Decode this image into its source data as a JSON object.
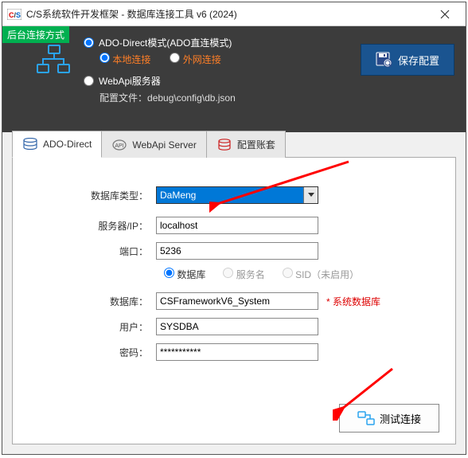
{
  "window": {
    "title": "C/S系统软件开发框架 - 数据库连接工具 v6 (2024)"
  },
  "header": {
    "tag": "后台连接方式",
    "mode1": "ADO-Direct模式(ADO直连模式)",
    "sub_local": "本地连接",
    "sub_remote": "外网连接",
    "mode2": "WebApi服务器",
    "config_label": "配置文件：",
    "config_path": "debug\\config\\db.json",
    "save_btn": "保存配置"
  },
  "tabs": {
    "t1": "ADO-Direct",
    "t2": "WebApi Server",
    "t3": "配置账套"
  },
  "form": {
    "db_type_label": "数据库类型：",
    "db_type_value": "DaMeng",
    "server_label": "服务器/IP：",
    "server_value": "localhost",
    "port_label": "端口：",
    "port_value": "5236",
    "opt_db": "数据库",
    "opt_svc": "服务名",
    "opt_sid": "SID（未启用）",
    "db_label": "数据库：",
    "db_value": "CSFrameworkV6_System",
    "db_hint": "* 系统数据库",
    "user_label": "用户：",
    "user_value": "SYSDBA",
    "pwd_label": "密码：",
    "pwd_value": "***********",
    "test_btn": "测试连接"
  }
}
